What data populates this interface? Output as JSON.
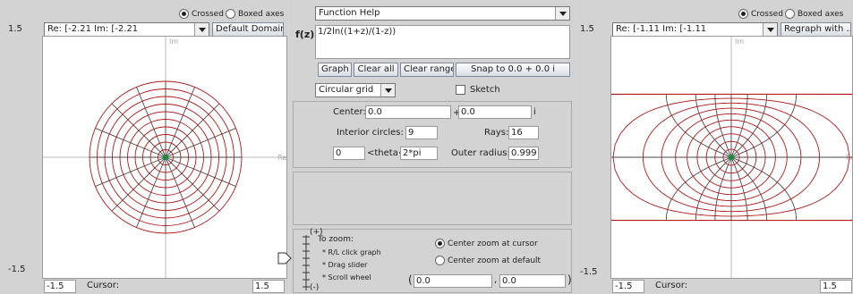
{
  "left": {
    "axis_mode": {
      "crossed": "Crossed",
      "boxed": "Boxed axes",
      "selected": "crossed"
    },
    "range_combo": "Re: [-2.21  Im: [-2.21",
    "domain_button": "Default Domain",
    "y_max": "1.5",
    "y_min": "-1.5",
    "x_min": "-1.5",
    "x_max": "1.5",
    "cursor_label": "Cursor:",
    "im_axis": "Im",
    "re_axis": "Re"
  },
  "middle": {
    "help_combo": "Function Help",
    "fz_label": "f(z)=",
    "function_text": "1/2ln((1+z)/(1-z))",
    "buttons": {
      "graph": "Graph",
      "clear_all": "Clear all",
      "clear_range": "Clear range",
      "snap": "Snap to 0.0 + 0.0 i"
    },
    "grid_combo": "Circular grid",
    "sketch_label": "Sketch",
    "center_label": "Center:",
    "center_re": "0.0",
    "center_plus": "+",
    "center_im": "0.0",
    "center_i": "i",
    "interior_label": "Interior circles:",
    "interior_value": "9",
    "rays_label": "Rays:",
    "rays_value": "16",
    "theta_min": "0",
    "theta_label": "<theta<",
    "theta_max": "2*pi",
    "outer_label": "Outer radius:",
    "outer_value": "0.999",
    "zoom": {
      "plus": "(+)",
      "minus": "(-)",
      "title": "To zoom:",
      "line1": "* R/L click graph",
      "line2": "* Drag slider",
      "line3": "* Scroll wheel",
      "opt_cursor": "Center zoom at cursor",
      "opt_default": "Center zoom at default",
      "selected": "cursor",
      "paren_open": "(",
      "coord_re": "0.0",
      "comma": ",",
      "coord_im": "0.0",
      "paren_close": ")"
    }
  },
  "right": {
    "axis_mode": {
      "crossed": "Crossed",
      "boxed": "Boxed axes",
      "selected": "crossed"
    },
    "range_combo": "Re: [-1.11  Im: [-1.11",
    "regraph_button": "Regraph with ...",
    "y_max": "1.5",
    "y_min": "-1.5",
    "x_min": "-1.5",
    "x_max": "1.5",
    "cursor_label": "Cursor:",
    "im_axis": "Im",
    "re_axis": "Re"
  },
  "colors": {
    "curve": "#b01818",
    "radial": "#4a4a4a",
    "center": "#1a8a3a",
    "axis": "#bbbbbb"
  }
}
